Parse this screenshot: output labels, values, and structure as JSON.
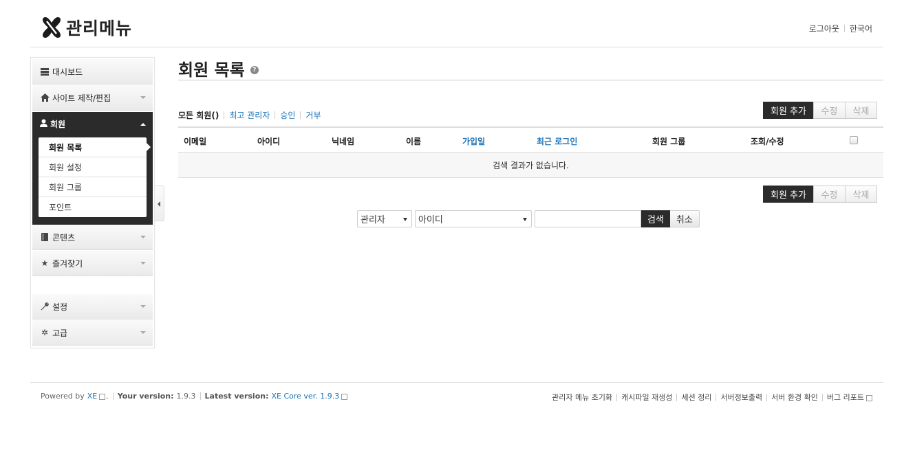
{
  "header": {
    "logo_text": "관리메뉴",
    "logout": "로그아웃",
    "language": "한국어"
  },
  "sidebar": {
    "items": [
      {
        "label": "대시보드",
        "icon": "list-icon"
      },
      {
        "label": "사이트 제작/편집",
        "icon": "home-icon"
      },
      {
        "label": "회원",
        "icon": "user-icon"
      },
      {
        "label": "콘텐츠",
        "icon": "book-icon"
      },
      {
        "label": "즐겨찾기",
        "icon": "star-icon"
      },
      {
        "label": "설정",
        "icon": "wrench-icon"
      },
      {
        "label": "고급",
        "icon": "gear-icon"
      }
    ],
    "member_sub": [
      "회원 목록",
      "회원 설정",
      "회원 그룹",
      "포인트"
    ]
  },
  "main": {
    "title": "회원 목록",
    "filters": [
      "모든 회원()",
      "최고 관리자",
      "승인",
      "거부"
    ],
    "buttons": {
      "add": "회원 추가",
      "edit": "수정",
      "delete": "삭제"
    },
    "columns": [
      "이메일",
      "아이디",
      "닉네임",
      "이름",
      "가입일",
      "최근 로그인",
      "회원 그룹",
      "조회/수정"
    ],
    "empty_message": "검색 결과가 없습니다.",
    "search": {
      "scope_select": "관리자",
      "field_select": "아이디",
      "button": "검색",
      "cancel": "취소"
    }
  },
  "footer": {
    "powered_by": "Powered by",
    "xe": "XE",
    "your_version_label": "Your version:",
    "your_version": "1.9.3",
    "latest_version_label": "Latest version:",
    "latest_version": "XE Core ver. 1.9.3",
    "links": [
      "관리자 메뉴 초기화",
      "캐시파일 재생성",
      "세션 정리",
      "서버정보출력",
      "서버 환경 확인",
      "버그 리포트"
    ]
  },
  "colors": {
    "accent": "#1a73b8",
    "dark": "#2b2b2b"
  }
}
